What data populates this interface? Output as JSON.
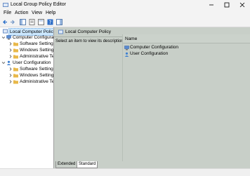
{
  "window": {
    "title": "Local Group Policy Editor"
  },
  "menu": [
    "File",
    "Action",
    "View",
    "Help"
  ],
  "tree": {
    "root": "Local Computer Policy",
    "nodes": [
      {
        "label": "Computer Configuration",
        "children": [
          "Software Settings",
          "Windows Settings",
          "Administrative Templates"
        ]
      },
      {
        "label": "User Configuration",
        "children": [
          "Software Settings",
          "Windows Settings",
          "Administrative Templates"
        ]
      }
    ]
  },
  "content": {
    "header": "Local Computer Policy",
    "description": "Select an item to view its description.",
    "column_name": "Name",
    "items": [
      "Computer Configuration",
      "User Configuration"
    ]
  },
  "tabs": [
    "Extended",
    "Standard"
  ],
  "colors": {
    "pane_bg": "#c8cfc8",
    "selection": "#cce8ff",
    "folder": "#e8b84a"
  }
}
